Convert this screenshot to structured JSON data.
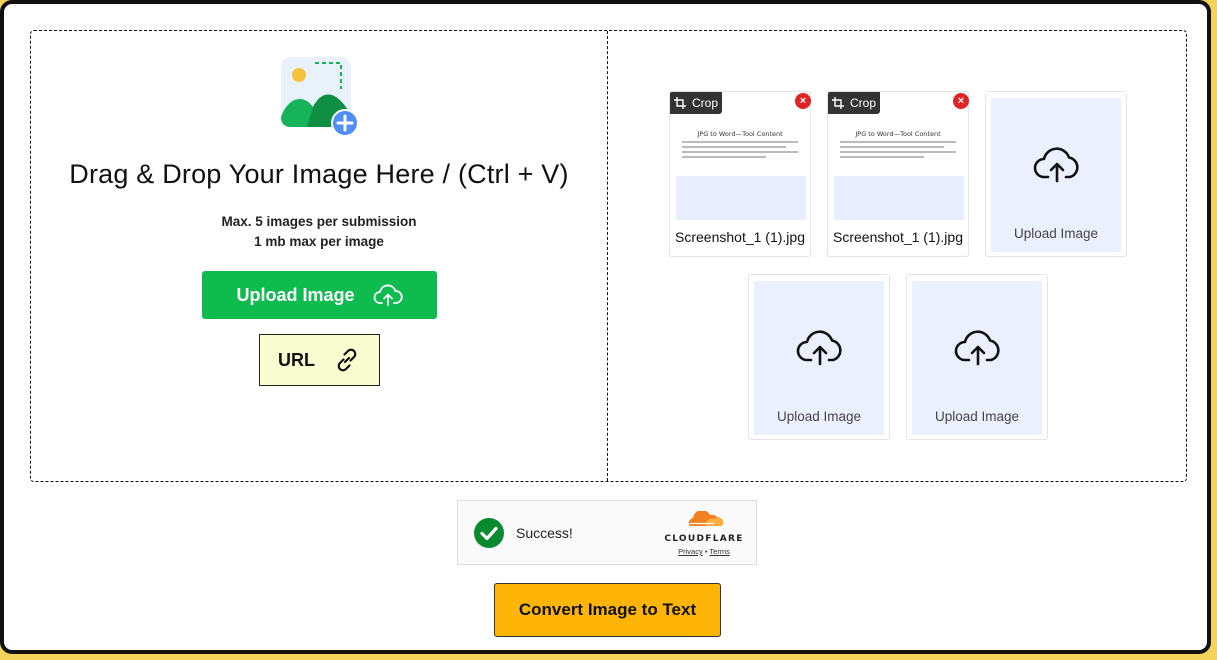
{
  "dropzone": {
    "title": "Drag & Drop Your Image Here / (Ctrl + V)",
    "limit_line1": "Max. 5 images per submission",
    "limit_line2": "1 mb max per image",
    "upload_button": "Upload Image",
    "url_button": "URL",
    "icons": {
      "hero": "add-image-icon",
      "upload": "cloud-upload-icon",
      "url": "link-icon"
    }
  },
  "uploads": {
    "files": [
      {
        "name": "Screenshot_1 (1).jpg",
        "crop_label": "Crop",
        "doc_title": "JPG to Word—Tool Content"
      },
      {
        "name": "Screenshot_1 (1).jpg",
        "crop_label": "Crop",
        "doc_title": "JPG to Word—Tool Content"
      }
    ],
    "empty_slots": [
      {
        "label": "Upload Image"
      },
      {
        "label": "Upload Image"
      },
      {
        "label": "Upload Image"
      }
    ]
  },
  "captcha": {
    "status": "Success!",
    "provider": "CLOUDFLARE",
    "privacy": "Privacy",
    "separator": "•",
    "terms": "Terms"
  },
  "convert_button": "Convert Image to Text",
  "colors": {
    "upload_green": "#0dbb4f",
    "convert_yellow": "#ffb507",
    "url_bg": "#f9fccf",
    "slot_bg": "#ebf0ff",
    "success_green": "#0a8a2e",
    "cloudflare_orange": "#f38020"
  }
}
